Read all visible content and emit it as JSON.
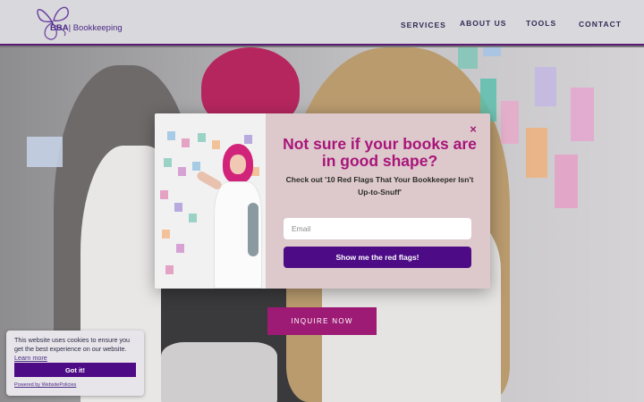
{
  "header": {
    "logo_bold": "BBA",
    "logo_text": "| Bookkeeping",
    "nav": [
      {
        "label": "SERVICES"
      },
      {
        "label": "ABOUT US"
      },
      {
        "label": "TOOLS"
      },
      {
        "label": "CONTACT"
      }
    ]
  },
  "hero": {
    "inquire_label": "INQUIRE NOW",
    "sticky_colors": [
      "#a7cbe4",
      "#e4a2c5",
      "#9ad3c6",
      "#f2c39a",
      "#b8a9de",
      "#d6a2d3"
    ]
  },
  "modal": {
    "title": "Not sure if your books are in good shape?",
    "subtitle": "Check out '10 Red Flags That Your Bookkeeper Isn't Up-to-Snuff'",
    "email_placeholder": "Email",
    "submit_label": "Show me the red flags!",
    "close_symbol": "×"
  },
  "cookie": {
    "text": "This website uses cookies to ensure you get the best experience on our website.",
    "learn_more": "Learn more",
    "accept_label": "Got it!",
    "powered_by": "Powered by WebsitePolicies"
  },
  "colors": {
    "brand_purple": "#4d0c86",
    "brand_magenta": "#a8157a",
    "header_border": "#5b1a73"
  }
}
